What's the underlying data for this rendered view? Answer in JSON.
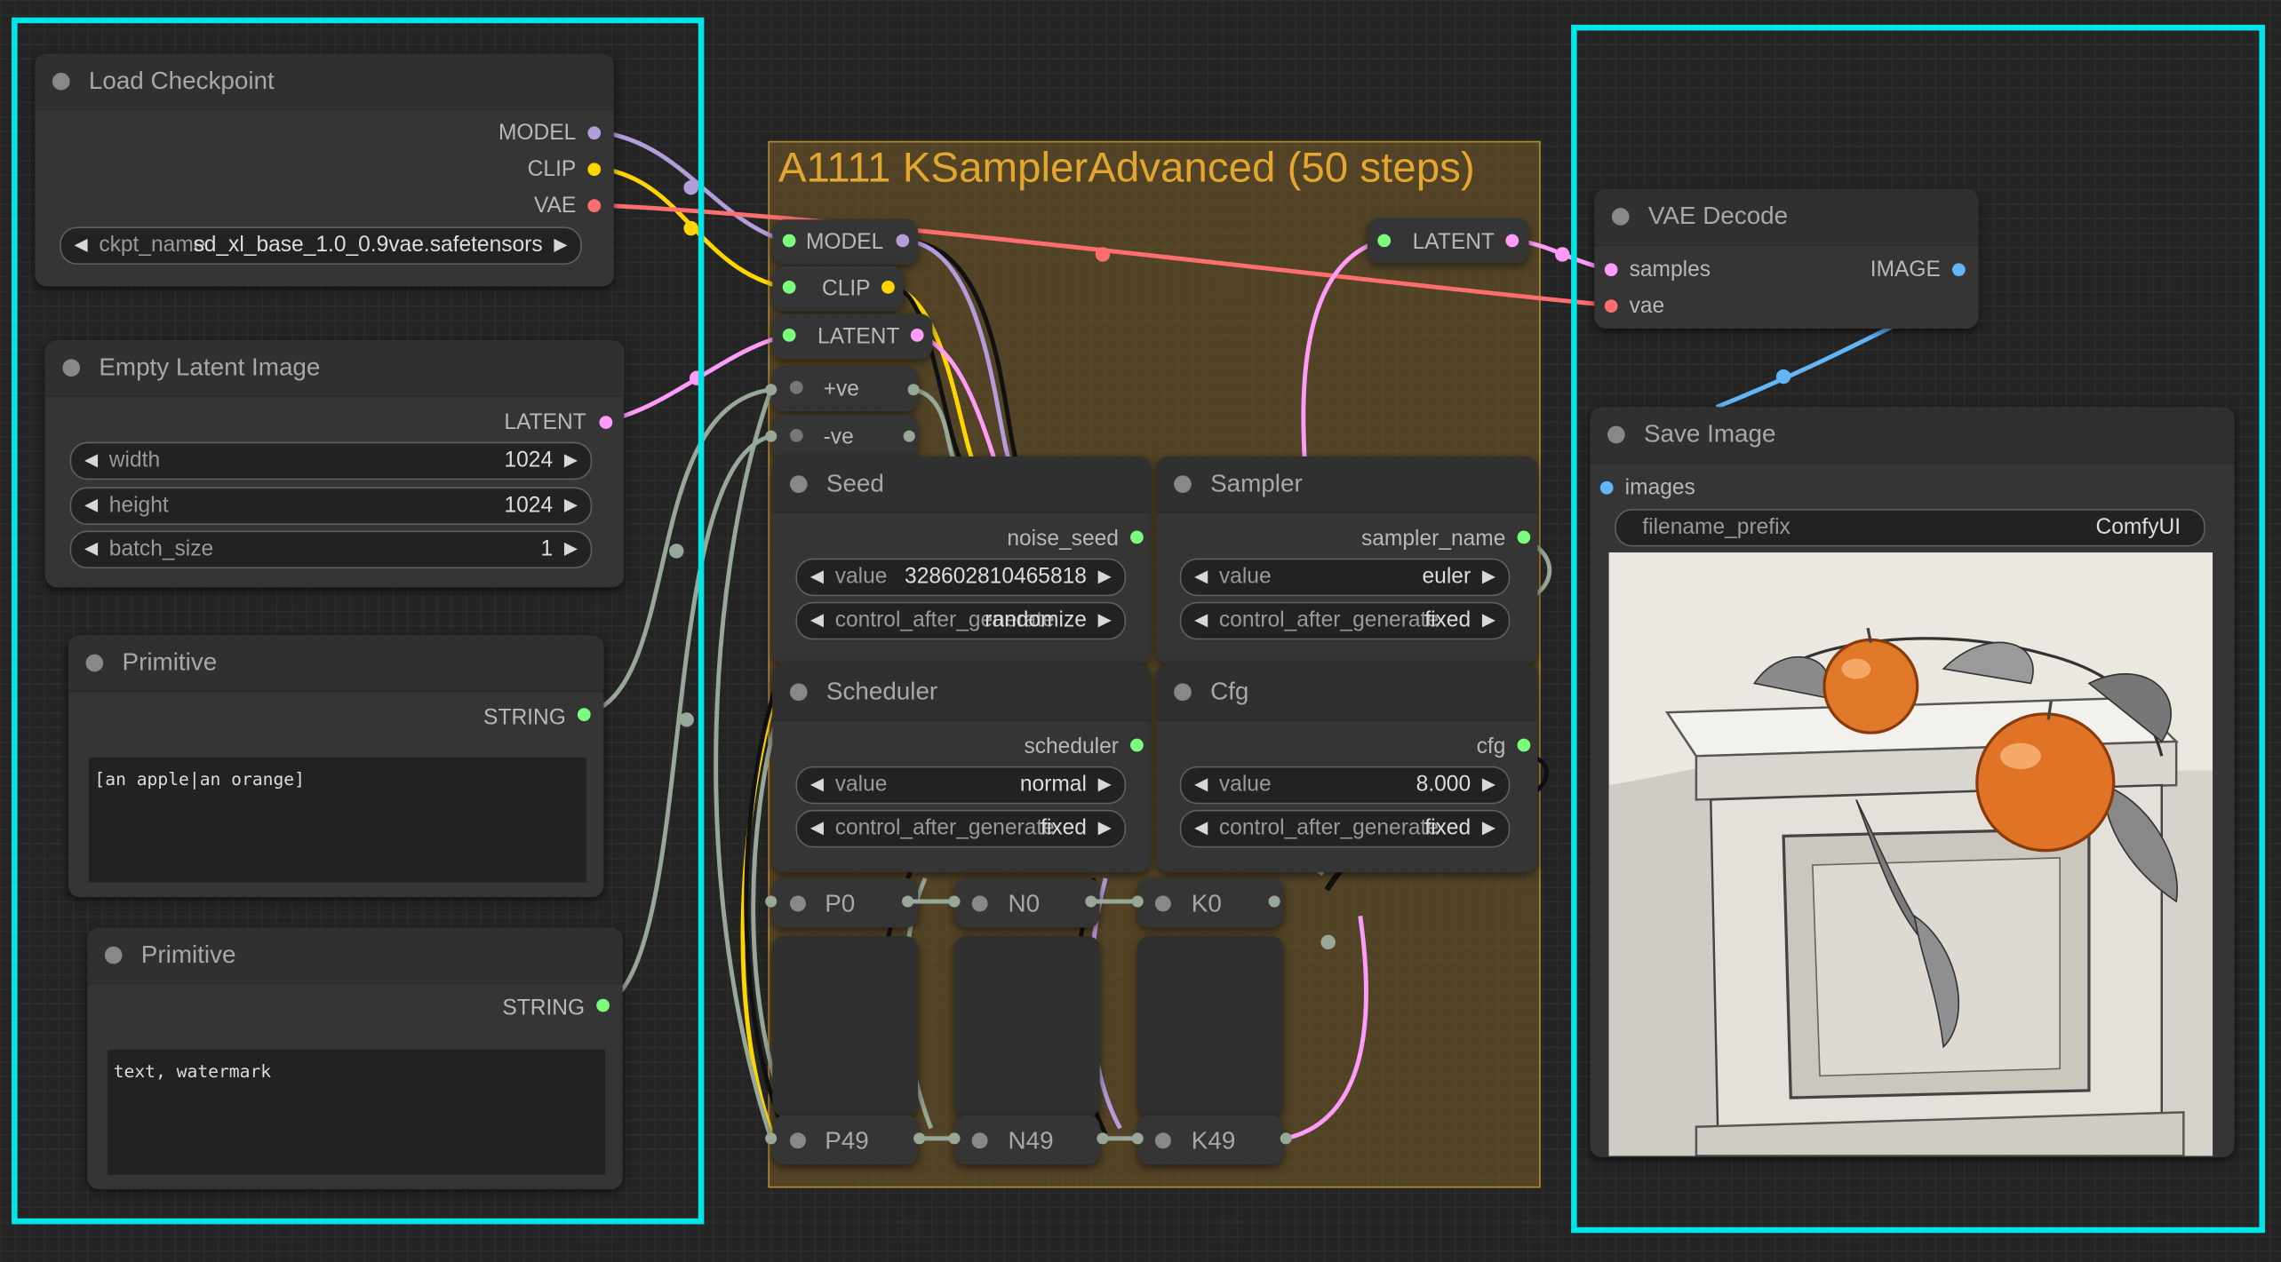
{
  "group": {
    "title": "A1111 KSamplerAdvanced (50 steps)",
    "color": "#e3a72f"
  },
  "nodes": {
    "load_checkpoint": {
      "title": "Load Checkpoint",
      "outputs": [
        "MODEL",
        "CLIP",
        "VAE"
      ],
      "widget": {
        "name": "ckpt_name",
        "value": "sd_xl_base_1.0_0.9vae.safetensors"
      }
    },
    "empty_latent": {
      "title": "Empty Latent Image",
      "output": "LATENT",
      "widgets": [
        {
          "name": "width",
          "value": "1024"
        },
        {
          "name": "height",
          "value": "1024"
        },
        {
          "name": "batch_size",
          "value": "1"
        }
      ]
    },
    "primitive_pos": {
      "title": "Primitive",
      "output": "STRING",
      "text": "[an apple|an orange]"
    },
    "primitive_neg": {
      "title": "Primitive",
      "output": "STRING",
      "text": "text, watermark"
    },
    "inputs_reroute": {
      "model": "MODEL",
      "clip": "CLIP",
      "latent": "LATENT",
      "pos": "+ve",
      "neg": "-ve"
    },
    "latent_out": {
      "label": "LATENT"
    },
    "seed": {
      "title": "Seed",
      "output": "noise_seed",
      "widgets": [
        {
          "name": "value",
          "value": "328602810465818"
        },
        {
          "name": "control_after_generate",
          "value": "randomize"
        }
      ]
    },
    "sampler": {
      "title": "Sampler",
      "output": "sampler_name",
      "widgets": [
        {
          "name": "value",
          "value": "euler"
        },
        {
          "name": "control_after_generate",
          "value": "fixed"
        }
      ]
    },
    "scheduler": {
      "title": "Scheduler",
      "output": "scheduler",
      "widgets": [
        {
          "name": "value",
          "value": "normal"
        },
        {
          "name": "control_after_generate",
          "value": "fixed"
        }
      ]
    },
    "cfg": {
      "title": "Cfg",
      "output": "cfg",
      "widgets": [
        {
          "name": "value",
          "value": "8.000"
        },
        {
          "name": "control_after_generate",
          "value": "fixed"
        }
      ]
    },
    "stack": {
      "p0": "P0",
      "n0": "N0",
      "k0": "K0",
      "p49": "P49",
      "n49": "N49",
      "k49": "K49"
    },
    "vae_decode": {
      "title": "VAE Decode",
      "inputs": [
        "samples",
        "vae"
      ],
      "output": "IMAGE"
    },
    "save_image": {
      "title": "Save Image",
      "input": "images",
      "widget": {
        "name": "filename_prefix",
        "value": "ComfyUI"
      }
    }
  },
  "colors": {
    "canvas": "#242424",
    "node_body": "#353535",
    "node_header": "#303030",
    "highlight_frame": "#00e5e5",
    "model": "#b39ddb",
    "clip": "#ffd500",
    "vae": "#ff6e6e",
    "latent": "#ff9cf9",
    "image": "#64b5f6",
    "string": "#98a898",
    "widget_output": "#7cfc7c"
  }
}
